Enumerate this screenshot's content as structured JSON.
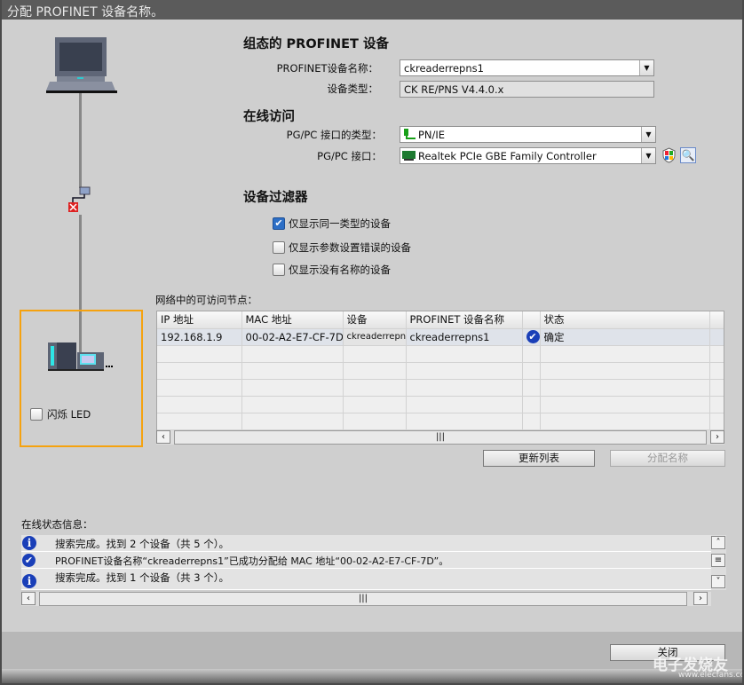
{
  "title": "分配 PROFINET 设备名称。",
  "configured": {
    "heading": "组态的 PROFINET 设备",
    "name_label": "PROFINET设备名称：",
    "name_value": "ckreaderrepns1",
    "type_label": "设备类型：",
    "type_value": "CK RE/PNS V4.4.0.x"
  },
  "online": {
    "heading": "在线访问",
    "iface_type_label": "PG/PC 接口的类型：",
    "iface_type_value": "PN/IE",
    "iface_label": "PG/PC 接口：",
    "iface_value": "Realtek PCIe GBE Family Controller"
  },
  "filter": {
    "heading": "设备过滤器",
    "options": [
      {
        "label": "仅显示同一类型的设备",
        "checked": true
      },
      {
        "label": "仅显示参数设置错误的设备",
        "checked": false
      },
      {
        "label": "仅显示没有名称的设备",
        "checked": false
      }
    ]
  },
  "nodes": {
    "label": "网络中的可访问节点：",
    "columns": [
      "IP 地址",
      "MAC 地址",
      "设备",
      "PROFINET 设备名称",
      "",
      "状态"
    ],
    "rows": [
      {
        "ip": "192.168.1.9",
        "mac": "00-02-A2-E7-CF-7D",
        "device": "ckreaderrepns",
        "name": "ckreaderrepns1",
        "status": "确定"
      }
    ],
    "refresh_label": "更新列表",
    "assign_label": "分配名称"
  },
  "flash_led": {
    "label": "闪烁 LED",
    "checked": false
  },
  "status": {
    "label": "在线状态信息：",
    "messages": [
      {
        "icon": "info",
        "text": "搜索完成。找到 2 个设备（共 5 个）。"
      },
      {
        "icon": "success",
        "text": "PROFINET设备名称“ckreaderrepns1”已成功分配给 MAC 地址“00-02-A2-E7-CF-7D”。"
      },
      {
        "icon": "info",
        "text": "搜索完成。找到 1 个设备（共 3 个）。"
      }
    ]
  },
  "close_label": "关闭",
  "watermark": {
    "brand": "电子发烧友",
    "url": "www.elecfans.com"
  }
}
